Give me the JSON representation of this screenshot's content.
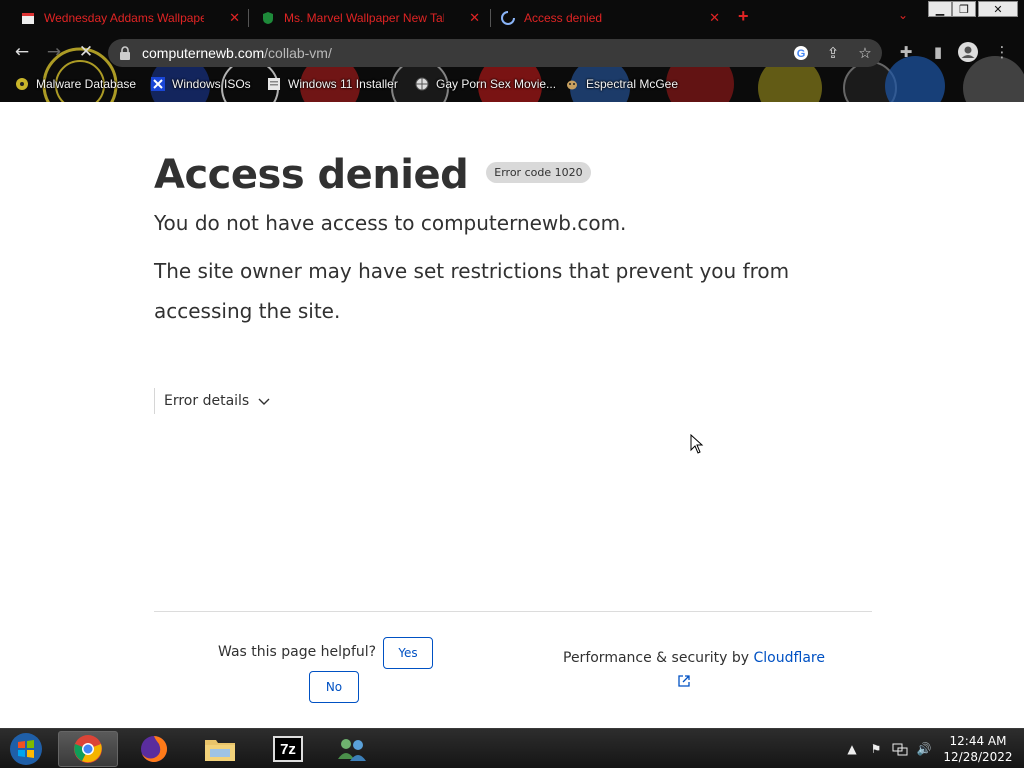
{
  "browser": {
    "tabs": [
      {
        "title": "Wednesday Addams Wallpapers",
        "icon": "calendar-icon"
      },
      {
        "title": "Ms. Marvel Wallpaper New Tab",
        "icon": "shield-icon"
      },
      {
        "title": "Access denied",
        "icon": "loading-spinner-icon",
        "active": true
      }
    ],
    "new_tab_label": "+",
    "tab_search_label": "⌄",
    "window_controls": {
      "minimize": "▁",
      "maximize": "❐",
      "close": "✕"
    },
    "url_host": "computernewb.com",
    "url_path": "/collab-vm/",
    "bookmarks": [
      {
        "label": "Malware Database",
        "icon": "biohazard-icon"
      },
      {
        "label": "Windows ISOs",
        "icon": "x-icon"
      },
      {
        "label": "Windows 11 Installer",
        "icon": "document-icon"
      },
      {
        "label": "Gay Porn Sex Movie...",
        "icon": "globe-icon"
      },
      {
        "label": "Espectral McGee",
        "icon": "dog-icon"
      }
    ]
  },
  "page": {
    "title": "Access denied",
    "error_code": "Error code 1020",
    "message_primary": "You do not have access to computernewb.com.",
    "message_secondary": "The site owner may have set restrictions that prevent you from accessing the site.",
    "error_details_label": "Error details",
    "helpful_question": "Was this page helpful?",
    "yes_label": "Yes",
    "no_label": "No",
    "performance_text": "Performance & security by",
    "cloudflare_link": "Cloudflare"
  },
  "taskbar": {
    "apps": [
      {
        "name": "start-button"
      },
      {
        "name": "chrome",
        "active": true
      },
      {
        "name": "firefox"
      },
      {
        "name": "file-explorer"
      },
      {
        "name": "7zip",
        "label": "7z"
      },
      {
        "name": "network-users"
      }
    ],
    "time": "12:44 AM",
    "date": "12/28/2022"
  },
  "colors": {
    "accent_link": "#0051c3",
    "text": "#313131",
    "tab_text": "#e02424"
  }
}
